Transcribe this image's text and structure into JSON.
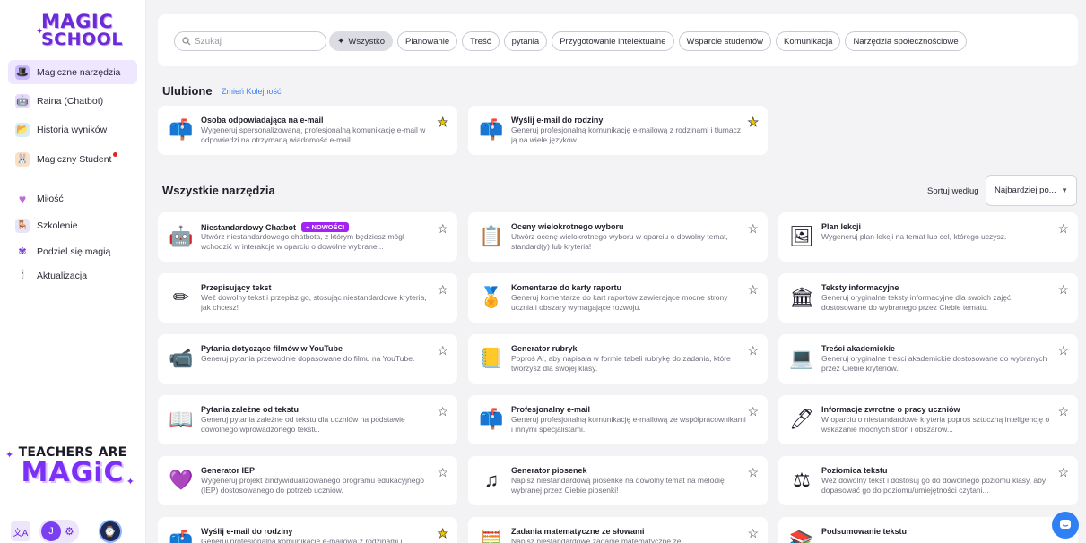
{
  "brand": {
    "logo_line1": "MAGIC",
    "logo_line2": "SCHOOL"
  },
  "sidebar": {
    "items": [
      {
        "label": "Magiczne narzędzia",
        "icon": "magic-hat-icon",
        "active": true
      },
      {
        "label": "Raina (Chatbot)",
        "icon": "robot-icon"
      },
      {
        "label": "Historia wyników",
        "icon": "folder-icon"
      },
      {
        "label": "Magiczny Student",
        "icon": "student-icon",
        "dot": true
      },
      {
        "label": "Miłość",
        "icon": "heart-icon"
      },
      {
        "label": "Szkolenie",
        "icon": "training-icon"
      },
      {
        "label": "Podziel się magią",
        "icon": "share-icon"
      },
      {
        "label": "Aktualizacja",
        "icon": "upgrade-icon"
      }
    ],
    "promo_line1": "TEACHERS ARE",
    "promo_line2": "MAGiC",
    "user_initial": "J"
  },
  "filters": {
    "search_placeholder": "Szukaj",
    "chips": [
      {
        "label": "Wszystko",
        "active": true
      },
      {
        "label": "Planowanie"
      },
      {
        "label": "Treść"
      },
      {
        "label": "pytania"
      },
      {
        "label": "Przygotowanie intelektualne"
      },
      {
        "label": "Wsparcie studentów"
      },
      {
        "label": "Komunikacja"
      },
      {
        "label": "Narzędzia społecznościowe"
      }
    ]
  },
  "favorites": {
    "title": "Ulubione",
    "reorder_link": "Zmień Kolejność",
    "cards": [
      {
        "title": "Osoba odpowiadająca na e-mail",
        "desc": "Wygeneruj spersonalizowaną, profesjonalną komunikację e-mail w odpowiedzi na otrzymaną wiadomość e-mail.",
        "icon": "mailbox-icon",
        "starred": true
      },
      {
        "title": "Wyślij e-mail do rodziny",
        "desc": "Generuj profesjonalną komunikację e-mailową z rodzinami i tłumacz ją na wiele języków.",
        "icon": "mailbox-icon",
        "starred": true
      }
    ]
  },
  "all_tools": {
    "title": "Wszystkie narzędzia",
    "sort_label": "Sortuj według",
    "sort_value": "Najbardziej po...",
    "new_badge": "+ NOWOŚCI",
    "cards": [
      {
        "title": "Niestandardowy Chatbot",
        "desc": "Utwórz niestandardowego chatbota, z którym będziesz mógł wchodzić w interakcje w oparciu o dowolne wybrane...",
        "icon": "robot-icon",
        "badge": true
      },
      {
        "title": "Oceny wielokrotnego wyboru",
        "desc": "Utwórz ocenę wielokrotnego wyboru w oparciu o dowolny temat, standard(y) lub kryteria!",
        "icon": "checklist-icon"
      },
      {
        "title": "Plan lekcji",
        "desc": "Wygeneruj plan lekcji na temat lub cel, którego uczysz.",
        "icon": "blackboard-icon"
      },
      {
        "title": "Przepisujący tekst",
        "desc": "Weź dowolny tekst i przepisz go, stosując niestandardowe kryteria, jak chcesz!",
        "icon": "pencil-icon"
      },
      {
        "title": "Komentarze do karty raportu",
        "desc": "Generuj komentarze do kart raportów zawierające mocne strony ucznia i obszary wymagające rozwoju.",
        "icon": "medal-icon"
      },
      {
        "title": "Teksty informacyjne",
        "desc": "Generuj oryginalne teksty informacyjne dla swoich zajęć, dostosowane do wybranego przez Ciebie tematu.",
        "icon": "museum-icon"
      },
      {
        "title": "Pytania dotyczące filmów w YouTube",
        "desc": "Generuj pytania przewodnie dopasowane do filmu na YouTube.",
        "icon": "video-camera-icon"
      },
      {
        "title": "Generator rubryk",
        "desc": "Poproś AI, aby napisała w formie tabeli rubrykę do zadania, które tworzysz dla swojej klasy.",
        "icon": "notebook-icon"
      },
      {
        "title": "Treści akademickie",
        "desc": "Generuj oryginalne treści akademickie dostosowane do wybranych przez Ciebie kryteriów.",
        "icon": "laptop-icon"
      },
      {
        "title": "Pytania zależne od tekstu",
        "desc": "Generuj pytania zależne od tekstu dla uczniów na podstawie dowolnego wprowadzonego tekstu.",
        "icon": "book-icon"
      },
      {
        "title": "Profesjonalny e-mail",
        "desc": "Generuj profesjonalną komunikację e-mailową ze współpracownikami i innymi specjalistami.",
        "icon": "mailbox-icon"
      },
      {
        "title": "Informacje zwrotne o pracy uczniów",
        "desc": "W oparciu o niestandardowe kryteria poproś sztuczną inteligencję o wskazanie mocnych stron i obszarów...",
        "icon": "pen-icon"
      },
      {
        "title": "Generator IEP",
        "desc": "Wygeneruj projekt zindywidualizowanego programu edukacyjnego (IEP) dostosowanego do potrzeb uczniów.",
        "icon": "heart-hand-icon"
      },
      {
        "title": "Generator piosenek",
        "desc": "Napisz niestandardową piosenkę na dowolny temat na melodię wybranej przez Ciebie piosenki!",
        "icon": "music-note-icon"
      },
      {
        "title": "Poziomica tekstu",
        "desc": "Weź dowolny tekst i dostosuj go do dowolnego poziomu klasy, aby dopasować go do poziomu/umiejętności czytani...",
        "icon": "scales-icon"
      },
      {
        "title": "Wyślij e-mail do rodziny",
        "desc": "Generuj profesjonalną komunikację e-mailową z rodzinami i",
        "icon": "mailbox-icon",
        "starred": true
      },
      {
        "title": "Zadania matematyczne ze słowami",
        "desc": "Napisz niestandardowe zadanie matematyczne ze",
        "icon": "calculator-icon"
      },
      {
        "title": "Podsumowanie tekstu",
        "desc": "",
        "icon": "books-icon"
      }
    ]
  },
  "colors": {
    "accent": "#6b2bd6",
    "active_bg": "#efe6ff",
    "star": "#f2c400",
    "link": "#3b82f6",
    "badge": "#a324f0",
    "help": "#2f7ff5"
  }
}
